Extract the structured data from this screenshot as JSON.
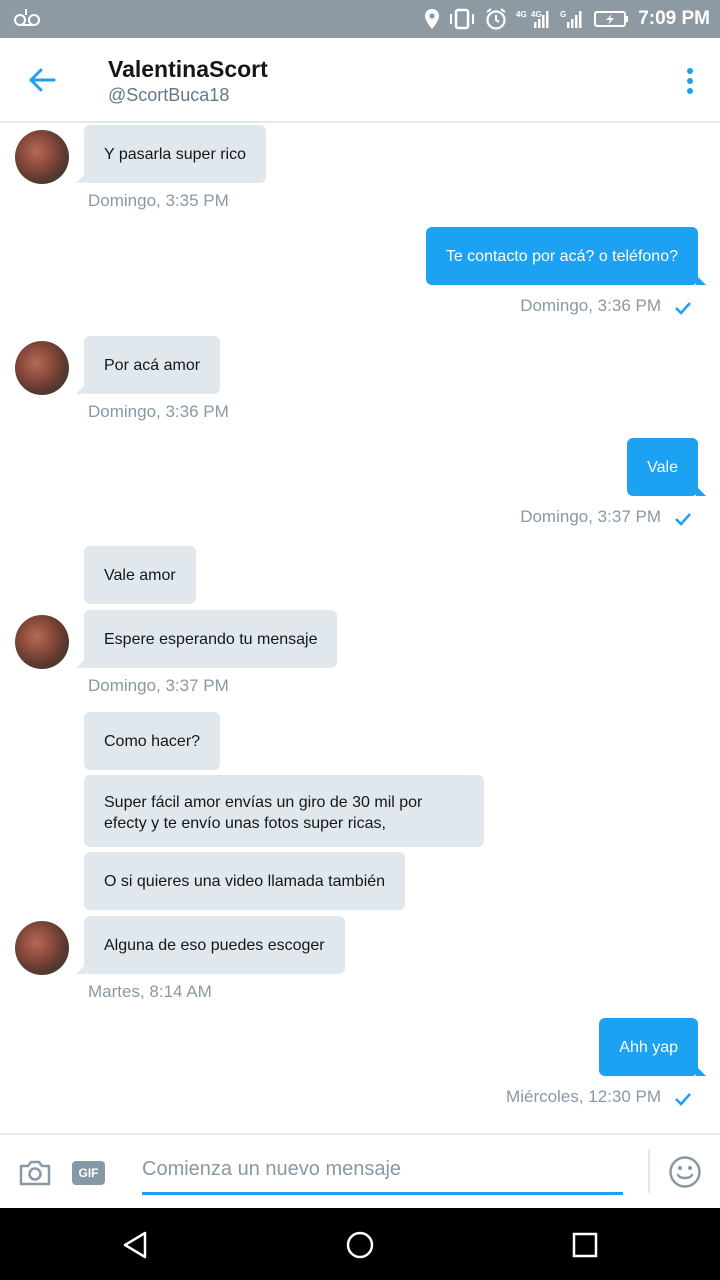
{
  "status_bar": {
    "time": "7:09 PM",
    "network_1": "4G",
    "network_2": "4G",
    "network_3": "G"
  },
  "header": {
    "title": "ValentinaScort",
    "handle": "@ScortBuca18"
  },
  "messages": [
    {
      "text": "Y pasarla super rico"
    },
    {
      "text": "Te contacto por acá? o teléfono?"
    },
    {
      "text": "Por acá amor"
    },
    {
      "text": "Vale"
    },
    {
      "text": "Vale amor"
    },
    {
      "text": "Espere esperando tu mensaje"
    },
    {
      "text": "Como hacer?"
    },
    {
      "text": "Super fácil amor envías un giro de 30 mil por efecty y te envío unas fotos super ricas,"
    },
    {
      "text": "O si quieres una video llamada también"
    },
    {
      "text": "Alguna de eso puedes escoger"
    },
    {
      "text": "Ahh yap"
    }
  ],
  "timestamps": [
    "Domingo, 3:35 PM",
    "Domingo, 3:36 PM",
    "Domingo, 3:36 PM",
    "Domingo, 3:37 PM",
    "Domingo, 3:37 PM",
    "Martes, 8:14 AM",
    "Miércoles, 12:30 PM"
  ],
  "composer": {
    "placeholder": "Comienza un nuevo mensaje",
    "gif_label": "GIF"
  },
  "colors": {
    "accent": "#1da1f2",
    "incoming_bubble": "#e1e8ed",
    "status_bar": "#8e9aa3",
    "muted_text": "#8899a6"
  },
  "icons": {
    "back": "arrow-left-icon",
    "menu": "more-vertical-icon",
    "camera": "camera-icon",
    "emoji": "smiley-icon",
    "sent": "checkmark-icon"
  }
}
